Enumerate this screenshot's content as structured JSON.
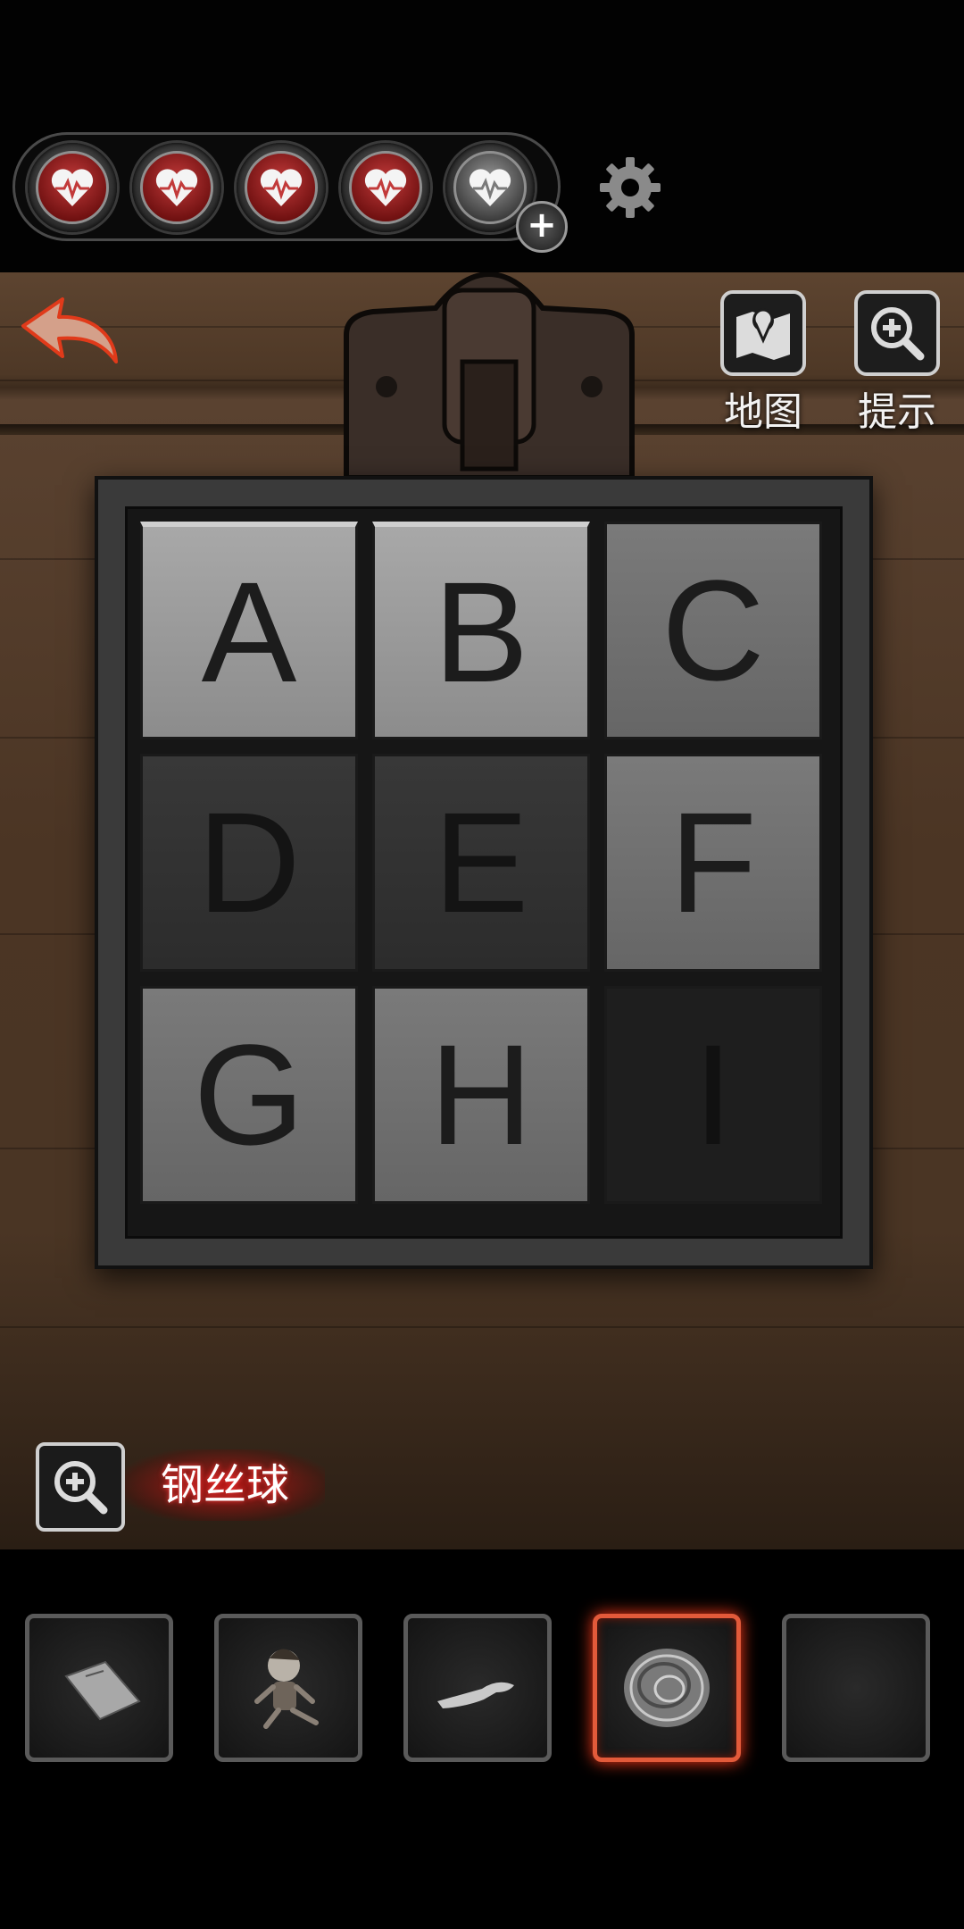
{
  "lives": {
    "filled": 4,
    "total": 5
  },
  "toolbar": {
    "map_label": "地图",
    "hint_label": "提示"
  },
  "puzzle": {
    "tiles": [
      {
        "letter": "A",
        "shade": "light"
      },
      {
        "letter": "B",
        "shade": "light"
      },
      {
        "letter": "C",
        "shade": "mid"
      },
      {
        "letter": "D",
        "shade": "dark"
      },
      {
        "letter": "E",
        "shade": "dark"
      },
      {
        "letter": "F",
        "shade": "mid"
      },
      {
        "letter": "G",
        "shade": "mid"
      },
      {
        "letter": "H",
        "shade": "mid"
      },
      {
        "letter": "I",
        "shade": "darker"
      }
    ]
  },
  "selected_item": {
    "name": "钢丝球"
  },
  "inventory": {
    "items": [
      {
        "icon": "paper-document-icon"
      },
      {
        "icon": "doll-icon"
      },
      {
        "icon": "hand-icon"
      },
      {
        "icon": "steel-wool-icon",
        "selected": true
      },
      {
        "icon": "empty-slot"
      }
    ]
  },
  "colors": {
    "accent_red": "#c23a3a",
    "selection_glow": "#ff3a1a"
  }
}
